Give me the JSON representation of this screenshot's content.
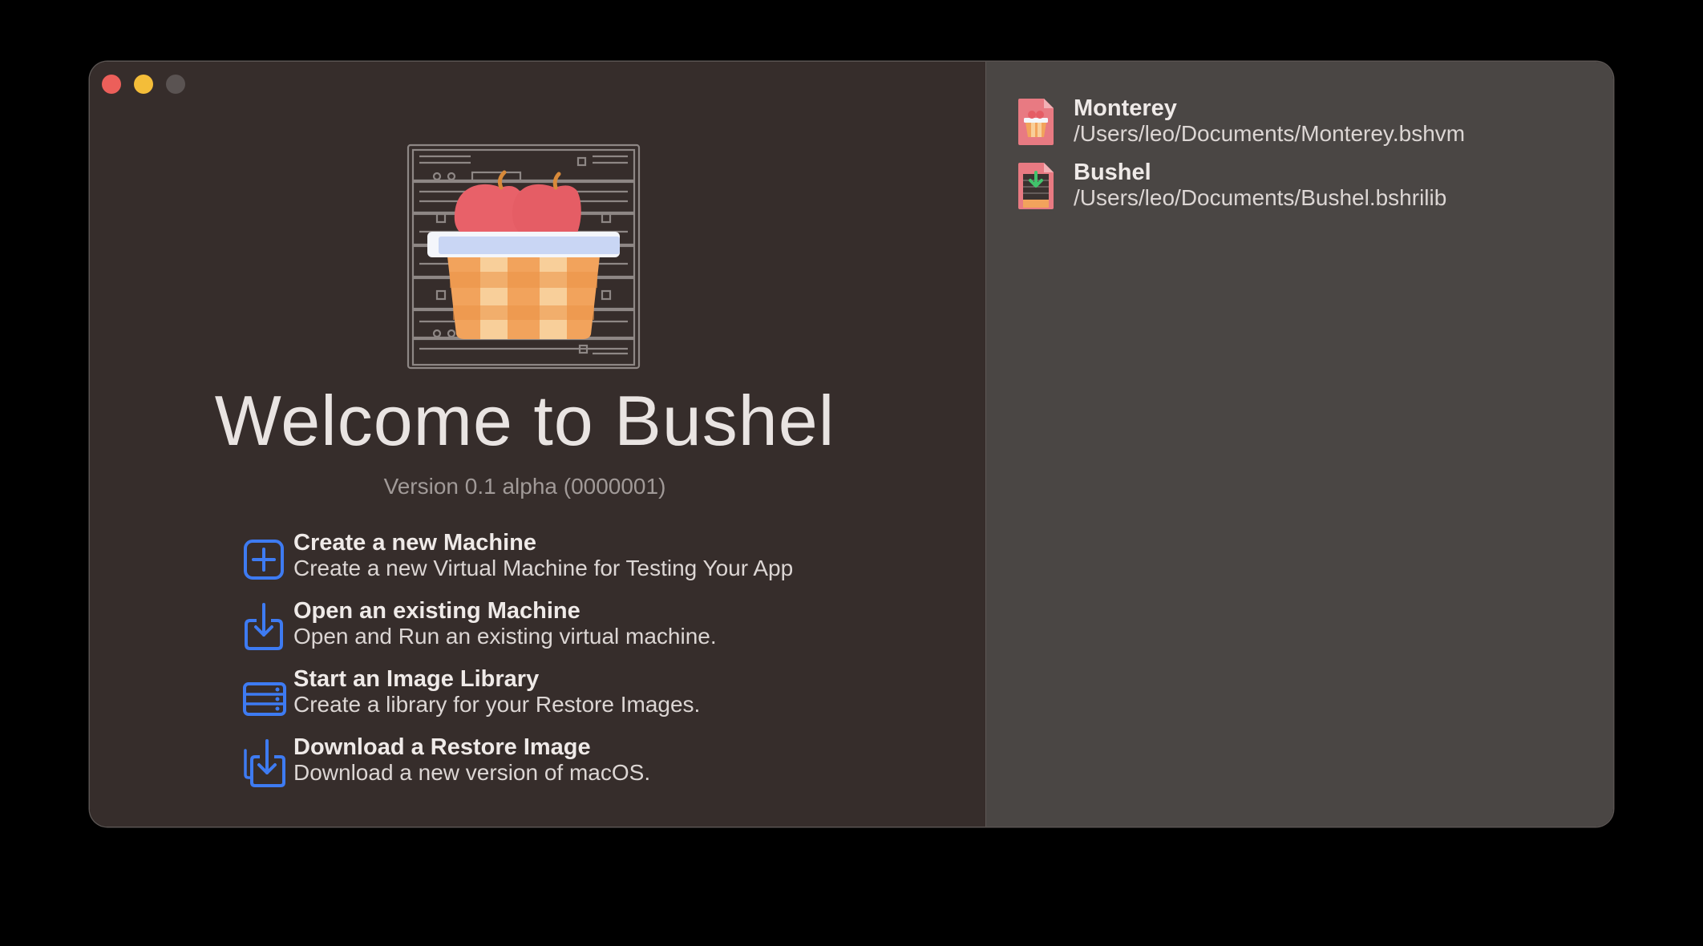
{
  "window": {
    "controls": {
      "close": "close-button",
      "minimize": "minimize-button",
      "zoom": "zoom-button"
    }
  },
  "welcome": {
    "title": "Welcome to Bushel",
    "version": "Version 0.1 alpha (0000001)"
  },
  "actions": [
    {
      "icon": "plus-square-icon",
      "title": "Create a new Machine",
      "description": "Create a new Virtual Machine for Testing Your App"
    },
    {
      "icon": "download-tray-icon",
      "title": "Open an existing Machine",
      "description": "Open and Run an existing virtual machine."
    },
    {
      "icon": "server-rack-icon",
      "title": "Start an Image Library",
      "description": "Create a library for your Restore Images."
    },
    {
      "icon": "download-stack-icon",
      "title": "Download a Restore Image",
      "description": "Download a new version of macOS."
    }
  ],
  "recent": [
    {
      "icon": "machine-document-icon",
      "name": "Monterey",
      "path": "/Users/leo/Documents/Monterey.bshvm"
    },
    {
      "icon": "library-document-icon",
      "name": "Bushel",
      "path": "/Users/leo/Documents/Bushel.bshrilib"
    }
  ],
  "colors": {
    "accent": "#3e7bf2",
    "left_background": "#362d2b",
    "right_background": "#4a4644"
  }
}
